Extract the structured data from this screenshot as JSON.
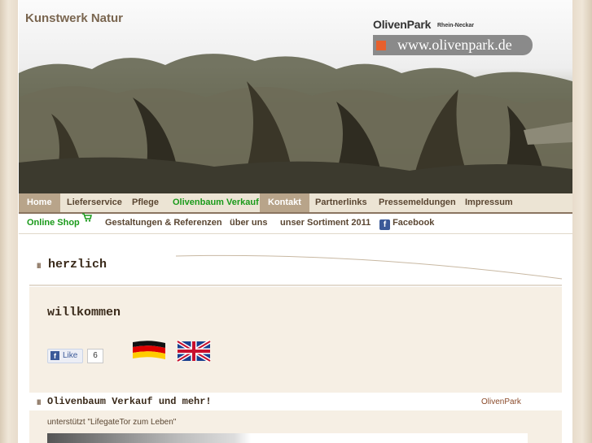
{
  "header": {
    "site_title": "Kunstwerk Natur",
    "logo_title": "OlivenPark",
    "logo_subtitle": "Rhein-Neckar",
    "logo_url": "www.olivenpark.de"
  },
  "nav_primary": [
    {
      "label": "Home",
      "state": "active"
    },
    {
      "label": "Lieferservice",
      "state": "normal"
    },
    {
      "label": "Pflege",
      "state": "normal"
    },
    {
      "label": "Olivenbaum Verkauf",
      "state": "highlight"
    },
    {
      "label": "Kontakt",
      "state": "active"
    },
    {
      "label": "Partnerlinks",
      "state": "normal"
    },
    {
      "label": "Pressemeldungen",
      "state": "normal"
    },
    {
      "label": "Impressum",
      "state": "normal"
    }
  ],
  "nav_secondary": [
    {
      "label": "Online Shop",
      "icon": "cart-icon"
    },
    {
      "label": "Gestaltungen & Referenzen"
    },
    {
      "label": "über uns"
    },
    {
      "label": "unser Sortiment 2011"
    },
    {
      "label": "Facebook",
      "icon": "facebook-icon"
    }
  ],
  "section1": {
    "heading": "herzlich",
    "subheading": "willkommen",
    "like_label": "Like",
    "like_count": "6"
  },
  "section2": {
    "heading": "Olivenbaum Verkauf und mehr!",
    "link": "OlivenPark",
    "support_text": "unterstützt \"LifegateTor zum Leben\""
  },
  "colors": {
    "accent_brown": "#8a7460",
    "highlight_green": "#1a9a1a",
    "content_bg": "#f6efe4",
    "logo_orange": "#e8602c"
  }
}
